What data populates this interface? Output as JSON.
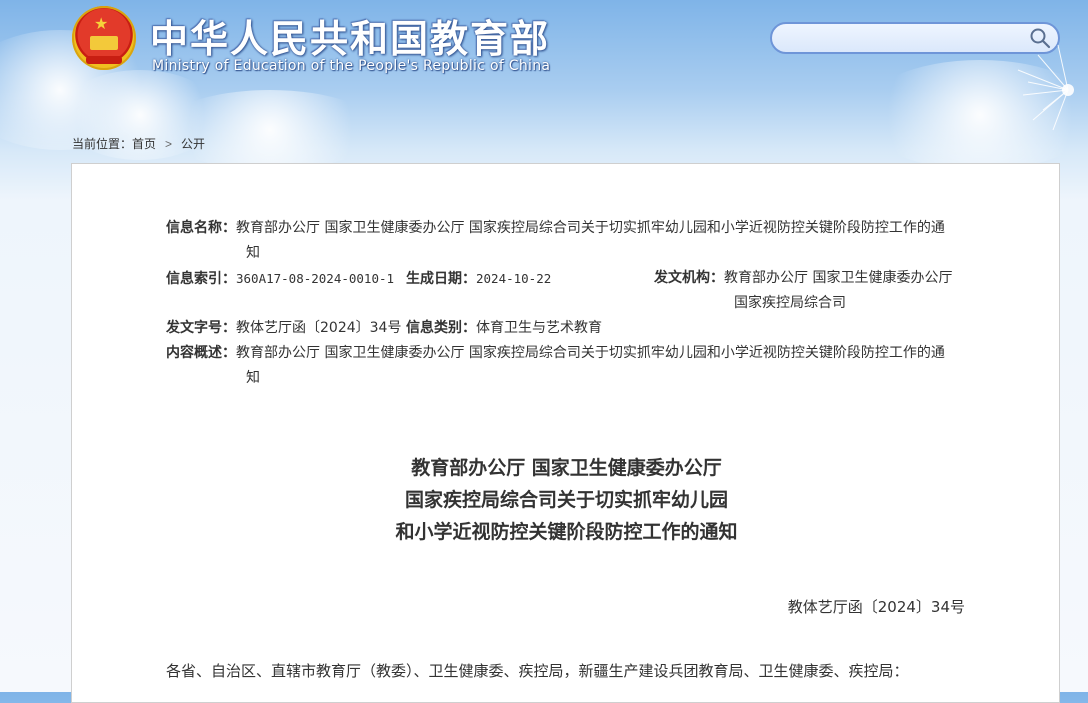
{
  "header": {
    "site_title_cn": "中华人民共和国教育部",
    "site_title_en": "Ministry of Education of the People's Republic of China",
    "search": {
      "placeholder": "",
      "value": ""
    }
  },
  "breadcrumb": {
    "prefix": "当前位置：",
    "items": [
      "首页",
      "公开"
    ],
    "separator": ">"
  },
  "meta": {
    "info_name_label": "信息名称：",
    "info_name_line1": "教育部办公厅 国家卫生健康委办公厅 国家疾控局综合司关于切实抓牢幼儿园和小学近视防控关键阶段防控工作的通",
    "info_name_line2": "知",
    "index_label": "信息索引：",
    "index_value": "360A17-08-2024-0010-1",
    "date_label": "生成日期：",
    "date_value": "2024-10-22",
    "issuer_label": "发文机构：",
    "issuer_line1": "教育部办公厅 国家卫生健康委办公厅",
    "issuer_line2": "国家疾控局综合司",
    "docno_label": "发文字号：",
    "docno_value": "教体艺厅函〔2024〕34号",
    "category_label": "信息类别：",
    "category_value": "体育卫生与艺术教育",
    "summary_label": "内容概述：",
    "summary_line1": "教育部办公厅 国家卫生健康委办公厅 国家疾控局综合司关于切实抓牢幼儿园和小学近视防控关键阶段防控工作的通",
    "summary_line2": "知"
  },
  "document": {
    "title_lines": [
      "教育部办公厅 国家卫生健康委办公厅",
      "国家疾控局综合司关于切实抓牢幼儿园",
      "和小学近视防控关键阶段防控工作的通知"
    ],
    "number": "教体艺厅函〔2024〕34号",
    "addressee": "各省、自治区、直辖市教育厅（教委）、卫生健康委、疾控局，新疆生产建设兵团教育局、卫生健康委、疾控局："
  },
  "colors": {
    "header_sky": "#7fb4e8",
    "search_border": "#6e95d8",
    "emblem_red": "#c81e12",
    "emblem_gold": "#f0c020"
  }
}
